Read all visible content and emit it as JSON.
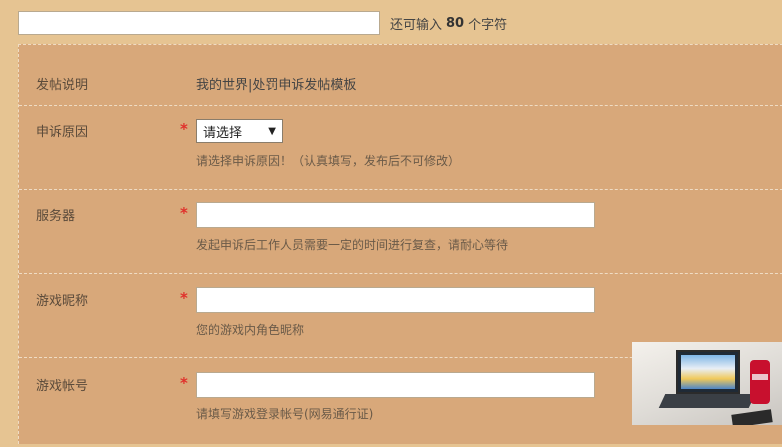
{
  "title_bar": {
    "input_value": "",
    "counter_prefix": "还可输入",
    "counter_value": "80",
    "counter_suffix": "个字符"
  },
  "form": {
    "notice": {
      "label": "发帖说明",
      "value": "我的世界|处罚申诉发帖模板"
    },
    "reason": {
      "label": "申诉原因",
      "required_mark": "*",
      "select_value": "请选择",
      "hint": "请选择申诉原因！（认真填写，发布后不可修改）"
    },
    "server": {
      "label": "服务器",
      "required_mark": "*",
      "value": "",
      "hint": "发起申诉后工作人员需要一定的时间进行复查，请耐心等待"
    },
    "nickname": {
      "label": "游戏昵称",
      "required_mark": "*",
      "value": "",
      "hint": "您的游戏内角色昵称"
    },
    "account": {
      "label": "游戏帐号",
      "required_mark": "*",
      "value": "",
      "hint": "请填写游戏登录帐号(网易通行证)"
    }
  },
  "icons": {
    "select_caret": "▼"
  },
  "colors": {
    "page_bg": "#e6c492",
    "panel_bg": "#d8a87a",
    "required": "#e0302b"
  }
}
